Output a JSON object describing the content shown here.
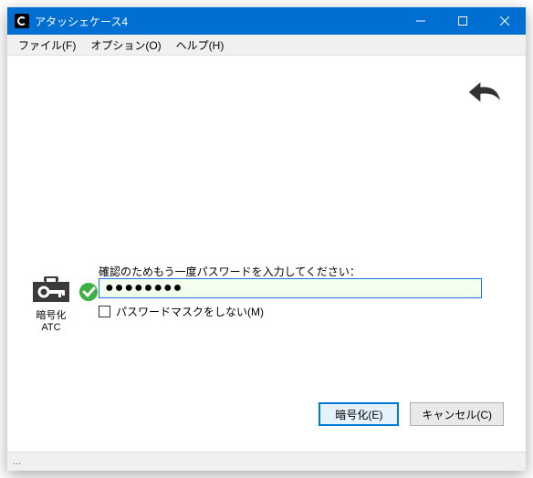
{
  "title": "アタッシェケース4",
  "menu": {
    "file": "ファイル(F)",
    "options": "オプション(O)",
    "help": "ヘルプ(H)"
  },
  "left": {
    "label_line1": "暗号化",
    "label_line2": "ATC"
  },
  "prompt": "確認のためもう一度パスワードを入力してください：",
  "password_display": "●●●●●●●●",
  "mask_checkbox_label": "パスワードマスクをしない(M)",
  "buttons": {
    "encrypt": "暗号化(E)",
    "cancel": "キャンセル(C)"
  },
  "status": "..."
}
